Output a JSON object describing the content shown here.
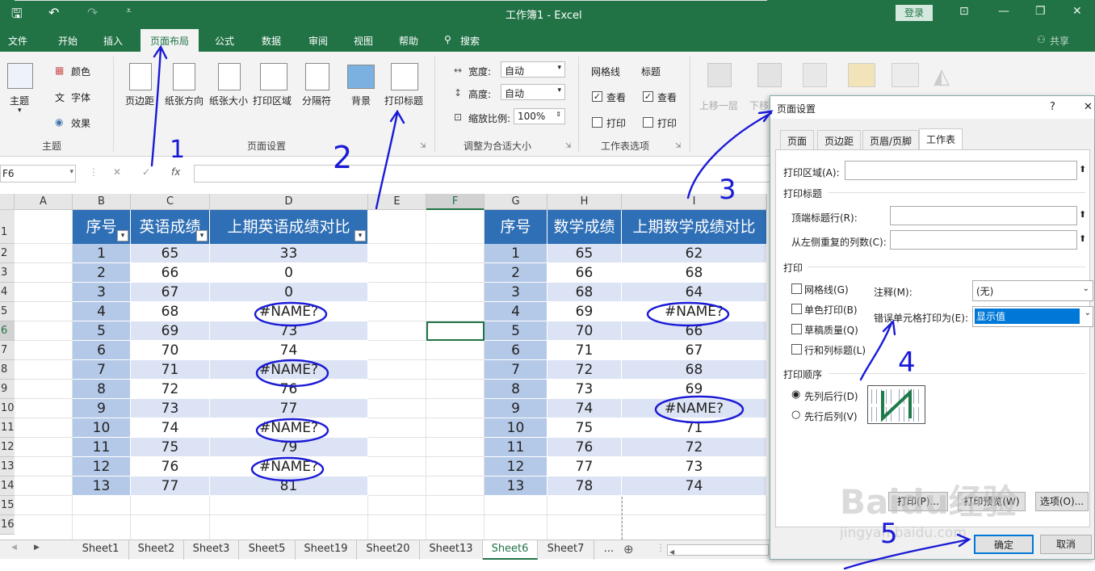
{
  "window": {
    "title": "工作簿1  -  Excel",
    "login": "登录"
  },
  "tabs": [
    "文件",
    "开始",
    "插入",
    "页面布局",
    "公式",
    "数据",
    "审阅",
    "视图",
    "帮助",
    "搜索"
  ],
  "share": "共享",
  "ribbon": {
    "theme": {
      "btn": "主题",
      "colors": "颜色",
      "fonts": "字体",
      "effects": "效果",
      "group": "主题"
    },
    "page_setup": {
      "margins": "页边距",
      "orientation": "纸张方向",
      "size": "纸张大小",
      "print_area": "打印区域",
      "breaks": "分隔符",
      "background": "背景",
      "print_titles": "打印标题",
      "group": "页面设置"
    },
    "scale": {
      "width_label": "宽度:",
      "width_val": "自动",
      "height_label": "高度:",
      "height_val": "自动",
      "scale_label": "缩放比例:",
      "scale_val": "100%",
      "group": "调整为合适大小"
    },
    "sheet_options": {
      "gridlines": "网格线",
      "headings": "标题",
      "view1": "查看",
      "view2": "查看",
      "print1": "打印",
      "print2": "打印",
      "group": "工作表选项"
    },
    "arrange": {
      "forward": "上移一层",
      "backward": "下移"
    }
  },
  "formula_bar": {
    "name_box": "F6",
    "fx": "fx"
  },
  "columns": [
    "A",
    "B",
    "C",
    "D",
    "E",
    "F",
    "G",
    "H",
    "I"
  ],
  "rows": [
    "1",
    "2",
    "3",
    "4",
    "5",
    "6",
    "7",
    "8",
    "9",
    "10",
    "11",
    "12",
    "13",
    "14",
    "15",
    "16"
  ],
  "table1": {
    "headers": [
      "序号",
      "英语成绩",
      "上期英语成绩对比"
    ],
    "rows": [
      [
        "1",
        "65",
        "33"
      ],
      [
        "2",
        "66",
        "0"
      ],
      [
        "3",
        "67",
        "0"
      ],
      [
        "4",
        "68",
        "#NAME?"
      ],
      [
        "5",
        "69",
        "73"
      ],
      [
        "6",
        "70",
        "74"
      ],
      [
        "7",
        "71",
        "#NAME?"
      ],
      [
        "8",
        "72",
        "76"
      ],
      [
        "9",
        "73",
        "77"
      ],
      [
        "10",
        "74",
        "#NAME?"
      ],
      [
        "11",
        "75",
        "79"
      ],
      [
        "12",
        "76",
        "#NAME?"
      ],
      [
        "13",
        "77",
        "81"
      ]
    ]
  },
  "table2": {
    "headers": [
      "序号",
      "数学成绩",
      "上期数学成绩对比"
    ],
    "rows": [
      [
        "1",
        "65",
        "62"
      ],
      [
        "2",
        "66",
        "68"
      ],
      [
        "3",
        "68",
        "64"
      ],
      [
        "4",
        "69",
        "#NAME?"
      ],
      [
        "5",
        "70",
        "66"
      ],
      [
        "6",
        "71",
        "67"
      ],
      [
        "7",
        "72",
        "68"
      ],
      [
        "8",
        "73",
        "69"
      ],
      [
        "9",
        "74",
        "#NAME?"
      ],
      [
        "10",
        "75",
        "71"
      ],
      [
        "11",
        "76",
        "72"
      ],
      [
        "12",
        "77",
        "73"
      ],
      [
        "13",
        "78",
        "74"
      ]
    ]
  },
  "sheet_tabs": [
    "Sheet1",
    "Sheet2",
    "Sheet3",
    "Sheet5",
    "Sheet19",
    "Sheet20",
    "Sheet13",
    "Sheet6",
    "Sheet7",
    "..."
  ],
  "dialog": {
    "title": "页面设置",
    "help": "?",
    "close": "✕",
    "tabs": [
      "页面",
      "页边距",
      "页眉/页脚",
      "工作表"
    ],
    "print_area": "打印区域(A):",
    "print_titles": "打印标题",
    "rows_repeat": "顶端标题行(R):",
    "cols_repeat": "从左侧重复的列数(C):",
    "print": "打印",
    "gridlines": "网格线(G)",
    "mono": "单色打印(B)",
    "draft": "草稿质量(Q)",
    "rowcol": "行和列标题(L)",
    "comments_label": "注释(M):",
    "comments_val": "(无)",
    "errors_label": "错误单元格打印为(E):",
    "errors_val": "显示值",
    "order": "打印顺序",
    "down_then_over": "先列后行(D)",
    "over_then_down": "先行后列(V)",
    "print_btn": "打印(P)...",
    "preview_btn": "打印预览(W)",
    "options_btn": "选项(O)...",
    "ok": "确定",
    "cancel": "取消"
  },
  "annotations": [
    "1",
    "2",
    "3",
    "4",
    "5"
  ],
  "watermark": {
    "brand": "Baidu经验",
    "url": "jingyan.baidu.com"
  },
  "colors": {
    "excel_green": "#217346",
    "table_header": "#2e6fb5",
    "band_light": "#dbe3f4",
    "band_dark": "#b4c8e8"
  }
}
